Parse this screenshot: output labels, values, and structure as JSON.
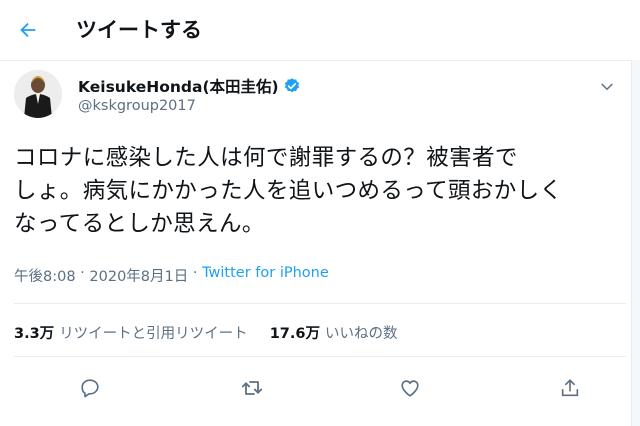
{
  "header": {
    "title": "ツイートする",
    "back_icon": "arrow-left-icon",
    "accent": "#1da1f2"
  },
  "author": {
    "display_name": "KeisukeHonda(本田圭佑)",
    "handle": "@kskgroup2017",
    "verified": true,
    "verified_icon": "verified-badge-icon"
  },
  "tweet": {
    "text": "コロナに感染した人は何で謝罪するの？被害者で\nしょ。病気にかかった人を追いつめるって頭おかしく\nなってるとしか思えん。",
    "time": "午後8:08",
    "separator": " · ",
    "date": "2020年8月1日",
    "source": "Twitter for iPhone"
  },
  "stats": {
    "retweets_count": "3.3万",
    "retweets_label": "リツイートと引用リツイート",
    "likes_count": "17.6万",
    "likes_label": "いいねの数"
  },
  "actions": [
    "reply-icon",
    "retweet-icon",
    "like-icon",
    "share-icon"
  ],
  "colors": {
    "text": "#0f1419",
    "secondary": "#5b7083",
    "link": "#1da1f2",
    "border": "#e6ecf0"
  }
}
